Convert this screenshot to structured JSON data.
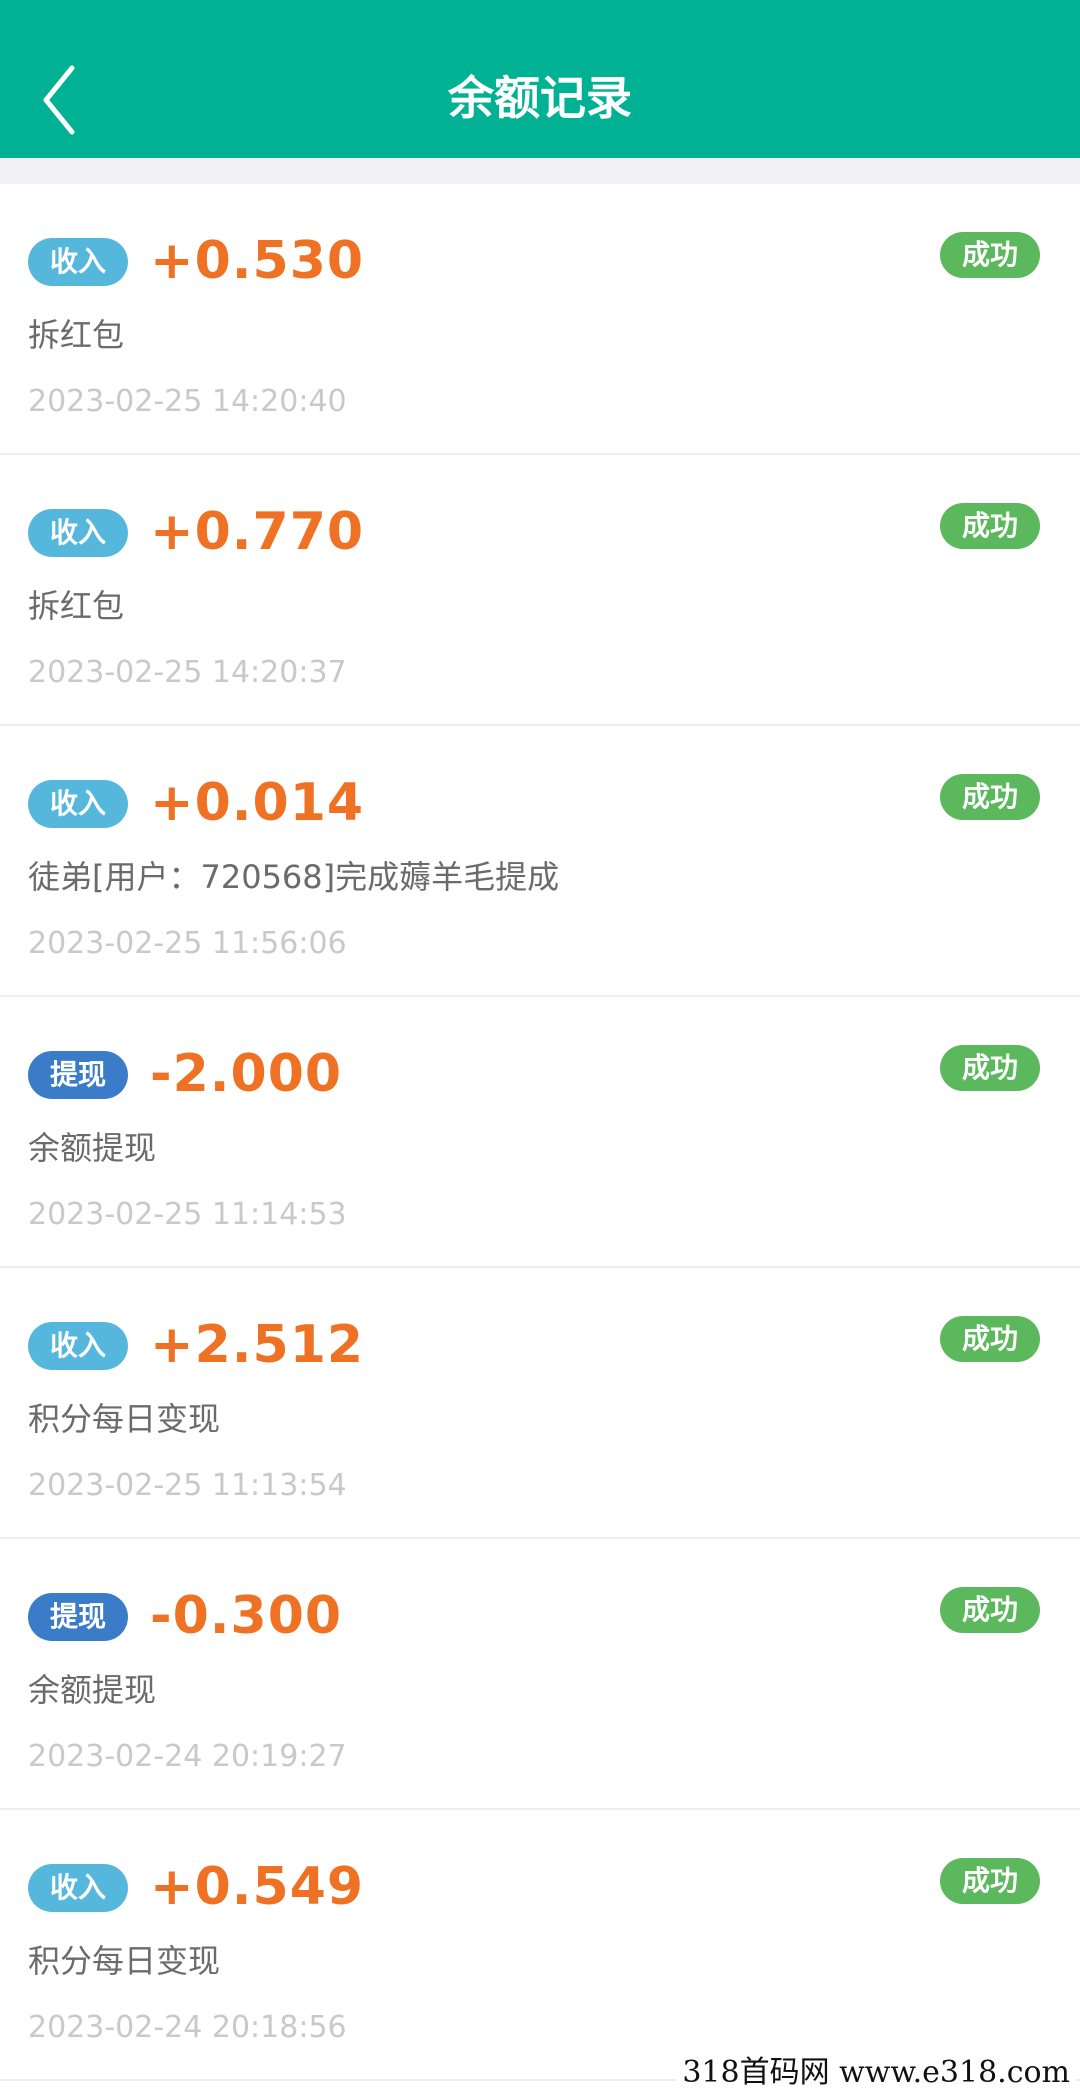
{
  "header": {
    "title": "余额记录",
    "back_icon": "chevron-left-icon"
  },
  "colors": {
    "header_bg": "#00b193",
    "amount": "#ef7224",
    "income_badge": "#56b7dd",
    "withdraw_badge": "#3a7cc7",
    "status_success": "#5cb85c"
  },
  "records": [
    {
      "type": "收入",
      "amount": "+0.530",
      "status": "成功",
      "desc": "拆红包",
      "time": "2023-02-25 14:20:40"
    },
    {
      "type": "收入",
      "amount": "+0.770",
      "status": "成功",
      "desc": "拆红包",
      "time": "2023-02-25 14:20:37"
    },
    {
      "type": "收入",
      "amount": "+0.014",
      "status": "成功",
      "desc": "徒弟[用户：720568]完成薅羊毛提成",
      "time": "2023-02-25 11:56:06"
    },
    {
      "type": "提现",
      "amount": "-2.000",
      "status": "成功",
      "desc": "余额提现",
      "time": "2023-02-25 11:14:53"
    },
    {
      "type": "收入",
      "amount": "+2.512",
      "status": "成功",
      "desc": "积分每日变现",
      "time": "2023-02-25 11:13:54"
    },
    {
      "type": "提现",
      "amount": "-0.300",
      "status": "成功",
      "desc": "余额提现",
      "time": "2023-02-24 20:19:27"
    },
    {
      "type": "收入",
      "amount": "+0.549",
      "status": "成功",
      "desc": "积分每日变现",
      "time": "2023-02-24 20:18:56"
    }
  ],
  "watermark": {
    "text": "318首码网  www.e318.com"
  }
}
